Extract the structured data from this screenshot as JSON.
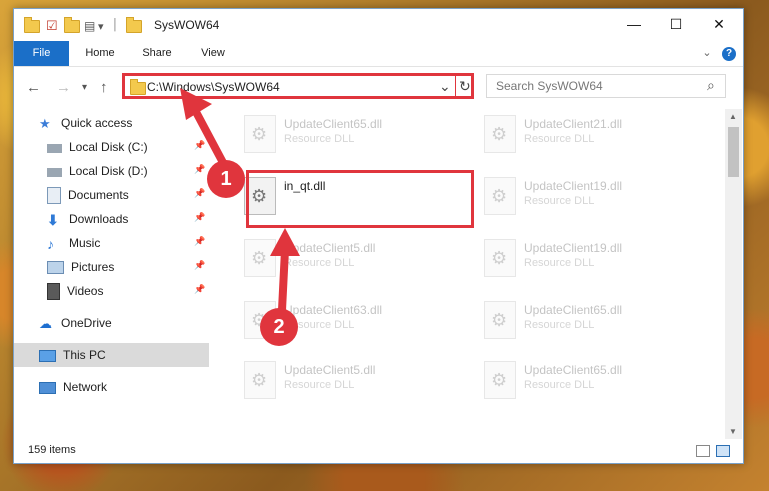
{
  "window": {
    "title": "SysWOW64",
    "minimize": "—",
    "maximize": "☐",
    "close": "✕"
  },
  "quick_access_toolbar": {
    "dropdown": "▾"
  },
  "ribbon": {
    "tabs": [
      "File",
      "Home",
      "Share",
      "View"
    ],
    "collapse": "⌄",
    "help": "?"
  },
  "address": {
    "back": "←",
    "forward": "→",
    "recent": "▾",
    "up": "↑",
    "path": "C:\\Windows\\SysWOW64",
    "dropdown": "⌄",
    "refresh": "↻",
    "search_placeholder": "Search SysWOW64",
    "search_icon": "⌕"
  },
  "navigation": {
    "quick_access": "Quick access",
    "items": [
      {
        "label": "Local Disk (C:)",
        "icon": "drive-icon",
        "pinned": true
      },
      {
        "label": "Local Disk (D:)",
        "icon": "drive-icon",
        "pinned": true
      },
      {
        "label": "Documents",
        "icon": "documents-icon",
        "pinned": true
      },
      {
        "label": "Downloads",
        "icon": "downloads-icon",
        "pinned": true
      },
      {
        "label": "Music",
        "icon": "music-icon",
        "pinned": true
      },
      {
        "label": "Pictures",
        "icon": "pictures-icon",
        "pinned": true
      },
      {
        "label": "Videos",
        "icon": "videos-icon",
        "pinned": true
      }
    ],
    "onedrive": "OneDrive",
    "this_pc": "This PC",
    "network": "Network",
    "pin_glyph": "📌"
  },
  "files": [
    {
      "name": "UpdateClient65.dll",
      "type": "Resource DLL"
    },
    {
      "name": "UpdateClient21.dll",
      "type": "Resource DLL"
    },
    {
      "name": "in_qt.dll",
      "type": ""
    },
    {
      "name": "UpdateClient19.dll",
      "type": "Resource DLL"
    },
    {
      "name": "UpdateClient5.dll",
      "type": "Resource DLL"
    },
    {
      "name": "UpdateClient19.dll",
      "type": "Resource DLL"
    },
    {
      "name": "UpdateClient63.dll",
      "type": "Resource DLL"
    },
    {
      "name": "UpdateClient65.dll",
      "type": "Resource DLL"
    },
    {
      "name": "UpdateClient5.dll",
      "type": "Resource DLL"
    },
    {
      "name": "UpdateClient65.dll",
      "type": "Resource DLL"
    }
  ],
  "annotations": {
    "step1": "1",
    "step2": "2"
  },
  "status": {
    "item_count": "159 items"
  },
  "colors": {
    "highlight": "#e0353d",
    "file_tab": "#1b6fc8"
  }
}
